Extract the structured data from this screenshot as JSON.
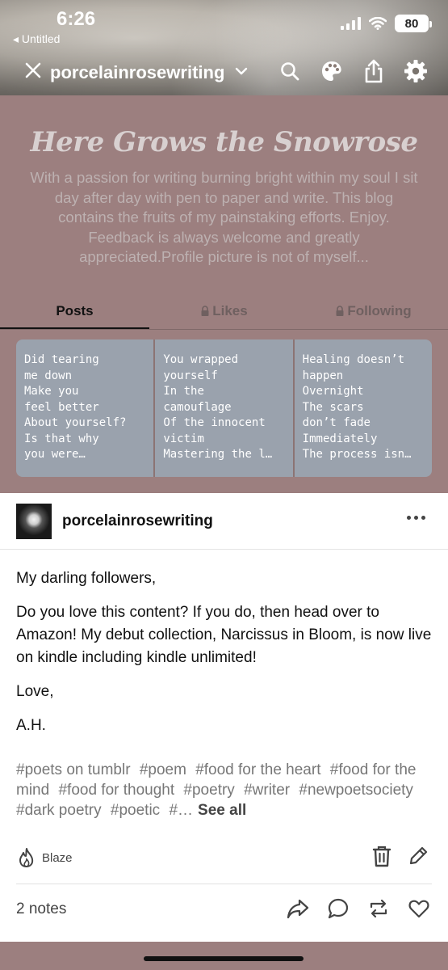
{
  "status": {
    "time": "6:26",
    "back_app": "Untitled",
    "battery": "80"
  },
  "nav": {
    "blog_name": "porcelainrosewriting",
    "icons": [
      "close-icon",
      "chevron-down-icon",
      "search-icon",
      "palette-icon",
      "share-icon",
      "gear-icon"
    ]
  },
  "blog": {
    "title": "Here Grows the Snowrose",
    "description": "With a passion for writing burning bright within my soul I sit day after day with pen to paper and write. This blog contains the fruits of my painstaking efforts. Enjoy. Feedback is always welcome and greatly appreciated.Profile picture is not of myself...",
    "tabs": [
      {
        "label": "Posts",
        "active": true,
        "locked": false
      },
      {
        "label": "Likes",
        "active": false,
        "locked": true
      },
      {
        "label": "Following",
        "active": false,
        "locked": true
      }
    ],
    "pinned_cards": [
      {
        "text": "Did tearing\nme down\nMake you\nfeel better\nAbout yourself?\nIs that why\nyou were…"
      },
      {
        "text": "You wrapped\nyourself\nIn the\ncamouflage\nOf the innocent\nvictim\nMastering the l…"
      },
      {
        "text": "Healing doesn’t\nhappen\nOvernight\nThe scars\ndon’t fade\nImmediately\nThe process isn…"
      }
    ]
  },
  "post": {
    "username": "porcelainrosewriting",
    "paragraphs": [
      "My darling followers,",
      "Do you love this content? If you do, then head over to Amazon! My debut collection, Narcissus in Bloom, is now live on kindle including kindle unlimited!",
      "Love,",
      "A.H."
    ],
    "tags": [
      "#poets on tumblr",
      "#poem",
      "#food for the heart",
      "#food for the mind",
      "#food for thought",
      "#poetry",
      "#writer",
      "#newpoetsociety",
      "#dark poetry",
      "#poetic",
      "#…"
    ],
    "see_all": "See all",
    "blaze_label": "Blaze",
    "notes": "2 notes"
  },
  "colors": {
    "header_bg": "#9c7f7f",
    "card_bg": "#9aa2ad",
    "title": "#d8d0d0"
  }
}
